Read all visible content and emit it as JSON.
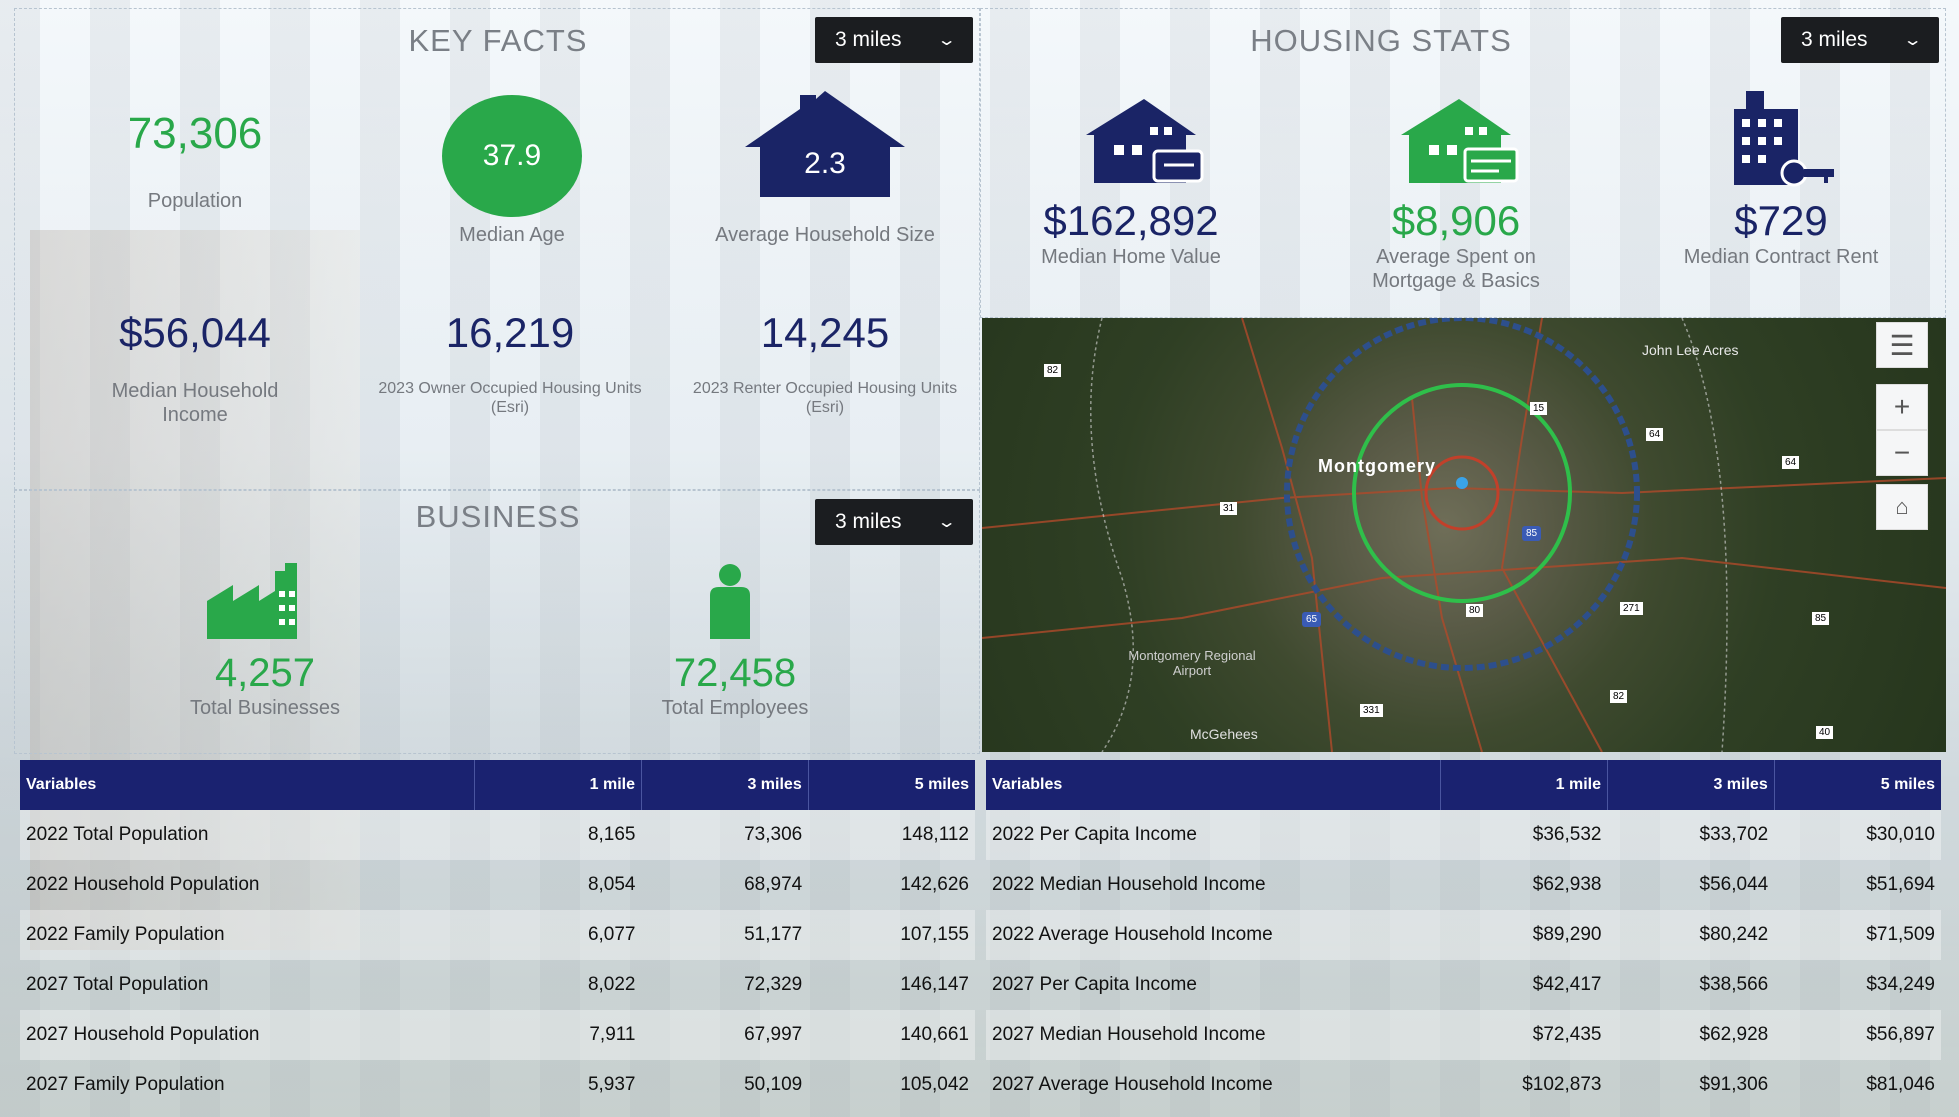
{
  "key_facts": {
    "title": "KEY FACTS",
    "radius": "3 miles",
    "population": {
      "value": "73,306",
      "label": "Population"
    },
    "median_age": {
      "value": "37.9",
      "label": "Median Age"
    },
    "household_size": {
      "value": "2.3",
      "label": "Average Household Size"
    },
    "median_income": {
      "value": "$56,044",
      "label": "Median Household Income"
    },
    "owner_units": {
      "value": "16,219",
      "label": "2023 Owner Occupied Housing Units (Esri)"
    },
    "renter_units": {
      "value": "14,245",
      "label": "2023 Renter Occupied Housing Units (Esri)"
    }
  },
  "business": {
    "title": "BUSINESS",
    "radius": "3 miles",
    "businesses": {
      "value": "4,257",
      "label": "Total Businesses"
    },
    "employees": {
      "value": "72,458",
      "label": "Total Employees"
    }
  },
  "housing": {
    "title": "HOUSING STATS",
    "radius": "3 miles",
    "home_value": {
      "value": "$162,892",
      "label": "Median Home Value"
    },
    "mortgage": {
      "value": "$8,906",
      "label": "Average Spent on Mortgage & Basics"
    },
    "rent": {
      "value": "$729",
      "label": "Median Contract Rent"
    }
  },
  "map": {
    "city": "Montgomery",
    "place1": "John Lee Acres",
    "place2": "Montgomery Regional Airport",
    "place3": "McGehees",
    "routes": [
      "82",
      "15",
      "64",
      "64",
      "31",
      "85",
      "80",
      "271",
      "85",
      "65",
      "82",
      "331",
      "40"
    ]
  },
  "colors": {
    "navy": "#1a2466",
    "green": "#29a84a",
    "header": "#1a2270"
  },
  "table_left": {
    "headers": [
      "Variables",
      "1 mile",
      "3 miles",
      "5 miles"
    ],
    "rows": [
      [
        "2022 Total Population",
        "8,165",
        "73,306",
        "148,112"
      ],
      [
        "2022 Household Population",
        "8,054",
        "68,974",
        "142,626"
      ],
      [
        "2022 Family Population",
        "6,077",
        "51,177",
        "107,155"
      ],
      [
        "2027 Total Population",
        "8,022",
        "72,329",
        "146,147"
      ],
      [
        "2027 Household Population",
        "7,911",
        "67,997",
        "140,661"
      ],
      [
        "2027 Family Population",
        "5,937",
        "50,109",
        "105,042"
      ]
    ]
  },
  "table_right": {
    "headers": [
      "Variables",
      "1 mile",
      "3 miles",
      "5 miles"
    ],
    "rows": [
      [
        "2022 Per Capita Income",
        "$36,532",
        "$33,702",
        "$30,010"
      ],
      [
        "2022 Median Household Income",
        "$62,938",
        "$56,044",
        "$51,694"
      ],
      [
        "2022 Average Household Income",
        "$89,290",
        "$80,242",
        "$71,509"
      ],
      [
        "2027 Per Capita Income",
        "$42,417",
        "$38,566",
        "$34,249"
      ],
      [
        "2027 Median Household Income",
        "$72,435",
        "$62,928",
        "$56,897"
      ],
      [
        "2027 Average Household Income",
        "$102,873",
        "$91,306",
        "$81,046"
      ]
    ]
  }
}
